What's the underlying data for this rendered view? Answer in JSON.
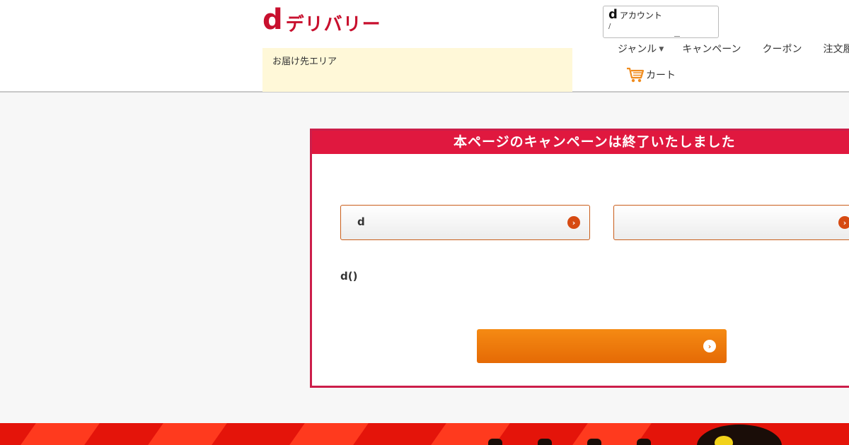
{
  "header": {
    "logo_d": "d",
    "logo_text": "デリバリー",
    "area_label": "お届け先エリア",
    "account": {
      "d": "d",
      "label": "アカウント",
      "sub": "/"
    },
    "nav": {
      "genre": "ジャンル",
      "campaign": "キャンペーン",
      "coupon": "クーポン",
      "history": "注文履歴"
    },
    "cart_label": "カート"
  },
  "campaign": {
    "title": "本ページのキャンペーンは終了いたしました",
    "link1_label": "d",
    "link2_label": "",
    "note": "d()",
    "main_button_label": "",
    "arrow_glyph": "›"
  },
  "colors": {
    "brand": "#c8102e",
    "campaign_header": "#e0183f",
    "area_bg": "#fff8d8",
    "main_button": "#f0780d",
    "banner": "#e4140a"
  }
}
